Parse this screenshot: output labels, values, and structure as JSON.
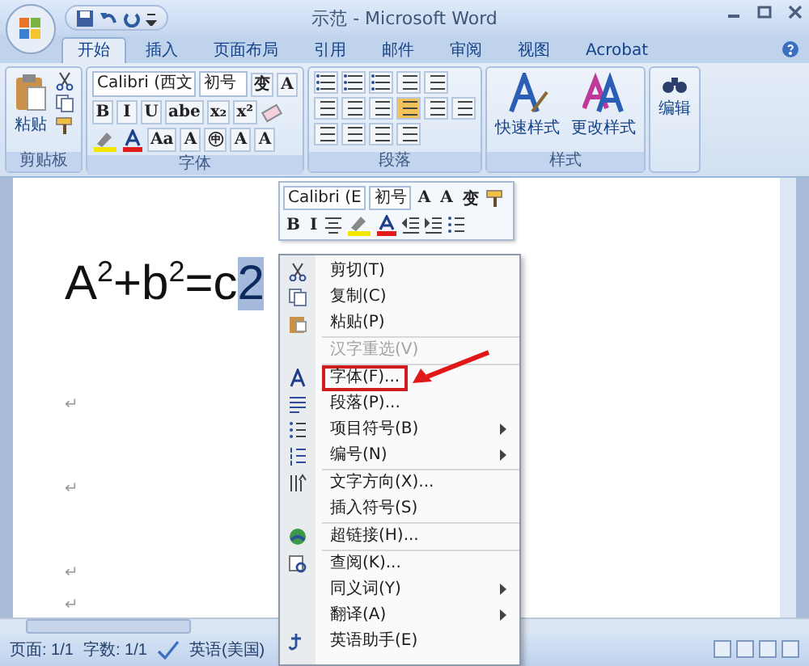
{
  "window": {
    "title": "示范 - Microsoft Word"
  },
  "tabs": [
    {
      "label": "开始",
      "selected": true
    },
    {
      "label": "插入",
      "selected": false
    },
    {
      "label": "页面布局",
      "selected": false
    },
    {
      "label": "引用",
      "selected": false
    },
    {
      "label": "邮件",
      "selected": false
    },
    {
      "label": "审阅",
      "selected": false
    },
    {
      "label": "视图",
      "selected": false
    },
    {
      "label": "Acrobat",
      "selected": false
    }
  ],
  "ribbon": {
    "groups": [
      {
        "kind": "clipboard",
        "title": "剪贴板",
        "buttons": [
          "粘贴"
        ]
      },
      {
        "kind": "font",
        "title": "字体",
        "font_name": "Calibri (西文",
        "font_size": "初号",
        "row_1": [
          "变",
          "A"
        ],
        "row_2": [
          "B",
          "I",
          "U",
          "abe",
          "x₂",
          "x²"
        ],
        "row_3": [
          "Aa",
          "A",
          "㊥",
          "A",
          "A"
        ]
      },
      {
        "kind": "paragraph",
        "title": "段落"
      },
      {
        "kind": "styles",
        "title": "样式",
        "buttons": [
          "快速样式",
          "更改样式"
        ]
      },
      {
        "kind": "editing",
        "buttons": [
          "编辑"
        ]
      }
    ]
  },
  "document": {
    "equation": "A$^{2}$+b$^{2}$=c",
    "selected_text": "2",
    "paragraph_marks": [
      "↵",
      "↵",
      "↵",
      "↵"
    ]
  },
  "mini_toolbar": {
    "font_name": "Calibri (E",
    "font_size": "初号",
    "row_1": [
      "A",
      "A",
      "变"
    ],
    "row_2": [
      "B",
      "I"
    ]
  },
  "context_menu": [
    {
      "kind": "item",
      "label": "剪切(T)",
      "disabled": false,
      "submenu": false,
      "marked": false
    },
    {
      "kind": "item",
      "label": "复制(C)",
      "disabled": false,
      "submenu": false,
      "marked": false
    },
    {
      "kind": "item",
      "label": "粘贴(P)",
      "disabled": false,
      "submenu": false,
      "marked": false
    },
    {
      "kind": "separator"
    },
    {
      "kind": "item",
      "label": "汉字重选(V)",
      "disabled": true,
      "submenu": false,
      "marked": false
    },
    {
      "kind": "separator"
    },
    {
      "kind": "item",
      "label": "字体(F)...",
      "disabled": false,
      "submenu": false,
      "marked": true
    },
    {
      "kind": "item",
      "label": "段落(P)...",
      "disabled": false,
      "submenu": false,
      "marked": false
    },
    {
      "kind": "item",
      "label": "项目符号(B)",
      "disabled": false,
      "submenu": true,
      "marked": false
    },
    {
      "kind": "item",
      "label": "编号(N)",
      "disabled": false,
      "submenu": true,
      "marked": false
    },
    {
      "kind": "separator"
    },
    {
      "kind": "item",
      "label": "文字方向(X)...",
      "disabled": false,
      "submenu": false,
      "marked": false
    },
    {
      "kind": "item",
      "label": "插入符号(S)",
      "disabled": false,
      "submenu": false,
      "marked": false
    },
    {
      "kind": "separator"
    },
    {
      "kind": "item",
      "label": "超链接(H)...",
      "disabled": false,
      "submenu": false,
      "marked": false
    },
    {
      "kind": "separator"
    },
    {
      "kind": "item",
      "label": "查阅(K)...",
      "disabled": false,
      "submenu": false,
      "marked": false
    },
    {
      "kind": "item",
      "label": "同义词(Y)",
      "disabled": false,
      "submenu": true,
      "marked": false
    },
    {
      "kind": "item",
      "label": "翻译(A)",
      "disabled": false,
      "submenu": true,
      "marked": false
    },
    {
      "kind": "item",
      "label": "英语助手(E)",
      "disabled": false,
      "submenu": false,
      "marked": false
    }
  ],
  "status_bar": [
    "页面: 1/1",
    "字数: 1/1",
    "英语(美国)"
  ]
}
